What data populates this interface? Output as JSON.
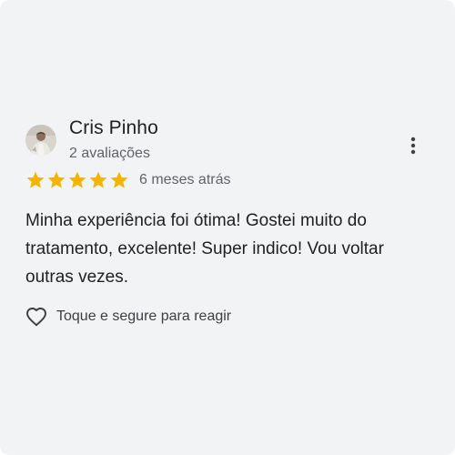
{
  "review": {
    "reviewer_name": "Cris Pinho",
    "reviewer_count": "2 avaliações",
    "rating": 5,
    "rating_max": 5,
    "date": "6 meses atrás",
    "text": "Minha experiência foi ótima! Gostei muito do tratamento, excelente! Super indico! Vou voltar outras vezes.",
    "react_label": "Toque e segure para reagir"
  },
  "icons": {
    "more": "more-vertical-icon",
    "star": "star-icon",
    "heart": "heart-outline-icon"
  },
  "colors": {
    "card_background": "#f2f3f5",
    "star": "#f4b400",
    "primary_text": "#202124",
    "secondary_text": "#5f6368"
  }
}
